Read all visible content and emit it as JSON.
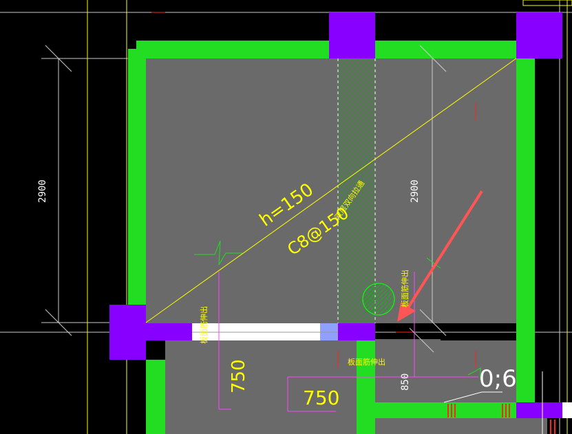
{
  "drawing": {
    "dimensions": {
      "left_vertical": "2900",
      "right_vertical": "2900",
      "lower_left": "750",
      "lower_mid": "750",
      "lower_right": "850"
    },
    "slab": {
      "thickness": "h=150",
      "rebar": "C8@150",
      "rebar_note": "双层双向拉通"
    },
    "notes": {
      "edge_rebar_left": "板面筋伸出",
      "edge_rebar_right": "板面筋伸出",
      "edge_rebar_bottom": "板面筋伸出"
    },
    "coordinate_readout": "0;6",
    "colors": {
      "wall": "#22dd22",
      "column": "#8800ff",
      "slab": "#6a6a6a",
      "annotation": "#ffff00",
      "arrow": "#ff5555",
      "grid": "#cccccc"
    }
  }
}
